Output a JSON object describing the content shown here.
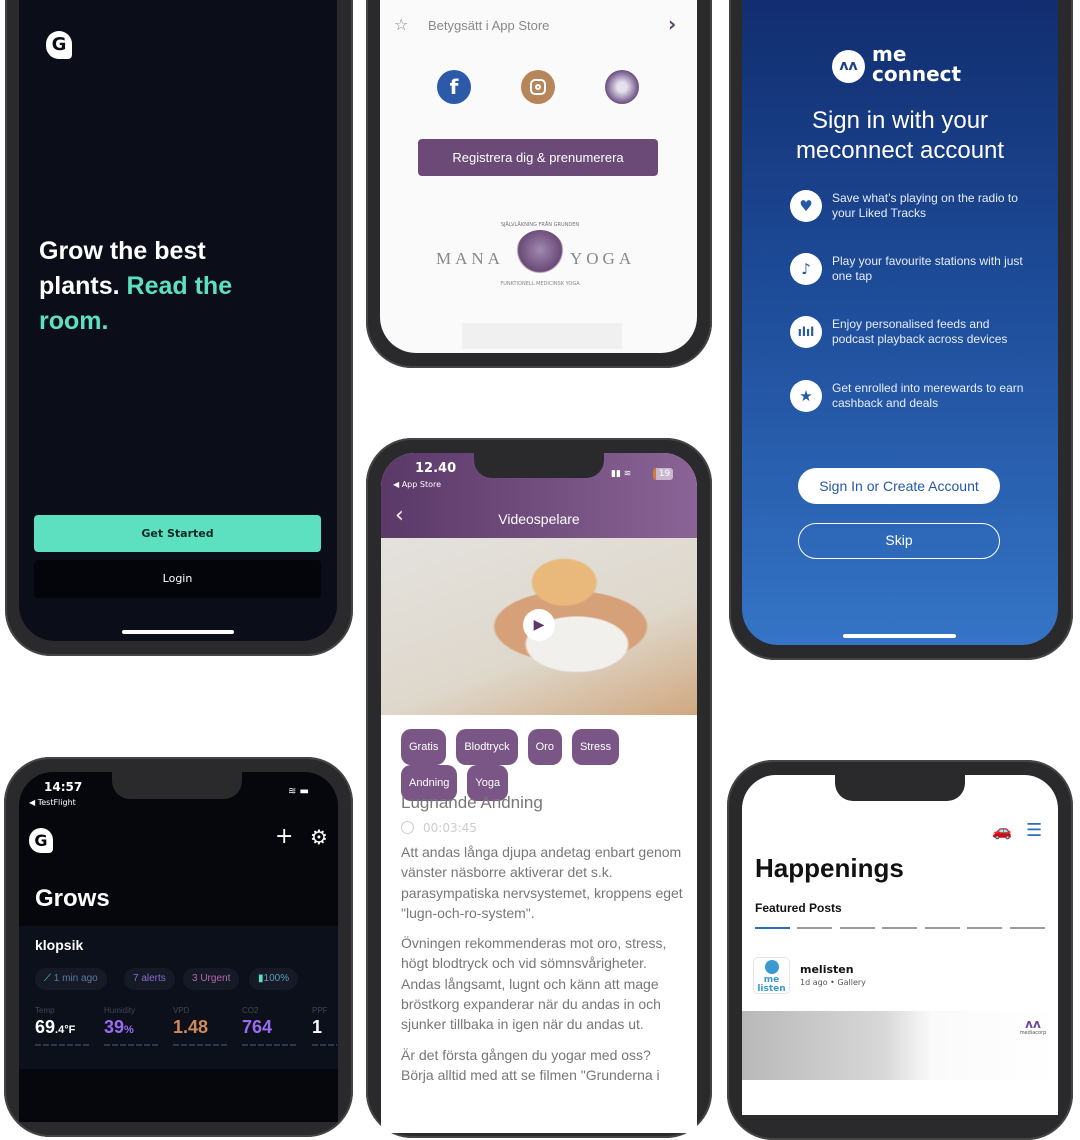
{
  "grow_onboarding": {
    "headline_white_1": "Grow the best",
    "headline_white_2": "plants.",
    "headline_accent": "Read the room.",
    "get_started": "Get Started",
    "login": "Login",
    "accent_color": "#5ce0c0"
  },
  "mana_yoga_settings": {
    "rate_label": "Betygsätt i App Store",
    "social_icons": [
      "facebook-icon",
      "instagram-icon",
      "mana-yoga-tree-icon"
    ],
    "register_button": "Registrera dig & prenumerera",
    "logo_left": "MANA",
    "logo_right": "YOGA",
    "logo_arc": "SJÄLVLÄKNING FRÅN GRUNDEN",
    "logo_tagline": "FUNKTIONELL MEDICINSK YOGA",
    "brand_color": "#6b4a78"
  },
  "meconnect": {
    "logo_line1": "me",
    "logo_line2": "connect",
    "heading_1": "Sign in with your",
    "heading_2": "meconnect account",
    "features": [
      {
        "icon": "heart-icon",
        "text": "Save what’s playing on the radio to your Liked Tracks"
      },
      {
        "icon": "music-note-icon",
        "text": "Play your favourite stations with just one tap"
      },
      {
        "icon": "equalizer-icon",
        "text": "Enjoy personalised feeds and podcast playback across devices"
      },
      {
        "icon": "star-icon",
        "text": "Get enrolled into merewards to earn cashback and deals"
      }
    ],
    "sign_in_button": "Sign In or Create Account",
    "skip_button": "Skip"
  },
  "video_player": {
    "status_time": "12.40",
    "back_app": "◀ App Store",
    "battery": "19",
    "title": "Videospelare",
    "tags": [
      "Gratis",
      "Blodtryck",
      "Oro",
      "Stress",
      "Andning",
      "Yoga"
    ],
    "video_title": "Lugnande Andning",
    "duration": "00:03:45",
    "paragraph_1": "Att andas långa djupa andetag enbart genom vänster näsborre aktiverar det s.k. parasympatiska nervsystemet, kroppens eget \"lugn-och-ro-system\".",
    "paragraph_2": "Övningen rekommenderas mot oro, stress, högt blodtryck och vid sömnsvårigheter. Andas långsamt, lugnt och känn att mage bröstkorg expanderar när du andas in och sjunker tillbaka in igen när du andas ut.",
    "paragraph_3": "Är det första gången du yogar med oss? Börja alltid med att se filmen \"Grunderna i"
  },
  "grows_dashboard": {
    "status_time": "14:57",
    "back_app": "◀ TestFlight",
    "title": "Grows",
    "grow_name": "klopsik",
    "chips": [
      "1 min ago",
      "7 alerts",
      "3 Urgent",
      "100%"
    ],
    "metrics": [
      {
        "label": "Temp",
        "value": "69",
        "unit": ".4°F",
        "color": "#ffffff"
      },
      {
        "label": "Humidity",
        "value": "39",
        "unit": "%",
        "color": "#9a6cf0"
      },
      {
        "label": "VPD",
        "value": "1.48",
        "unit": "",
        "color": "#d08a5c"
      },
      {
        "label": "CO2",
        "value": "764",
        "unit": "",
        "color": "#9a6cf0"
      },
      {
        "label": "PPF",
        "value": "1",
        "unit": "",
        "color": "#ffffff"
      }
    ]
  },
  "happenings": {
    "title": "Happenings",
    "section": "Featured Posts",
    "post_author": "melisten",
    "post_meta": "1d ago • Gallery",
    "avatar_text_1": "me",
    "avatar_text_2": "listen",
    "watermark": "mediacorp",
    "carousel_pages": 7,
    "carousel_active": 1
  }
}
